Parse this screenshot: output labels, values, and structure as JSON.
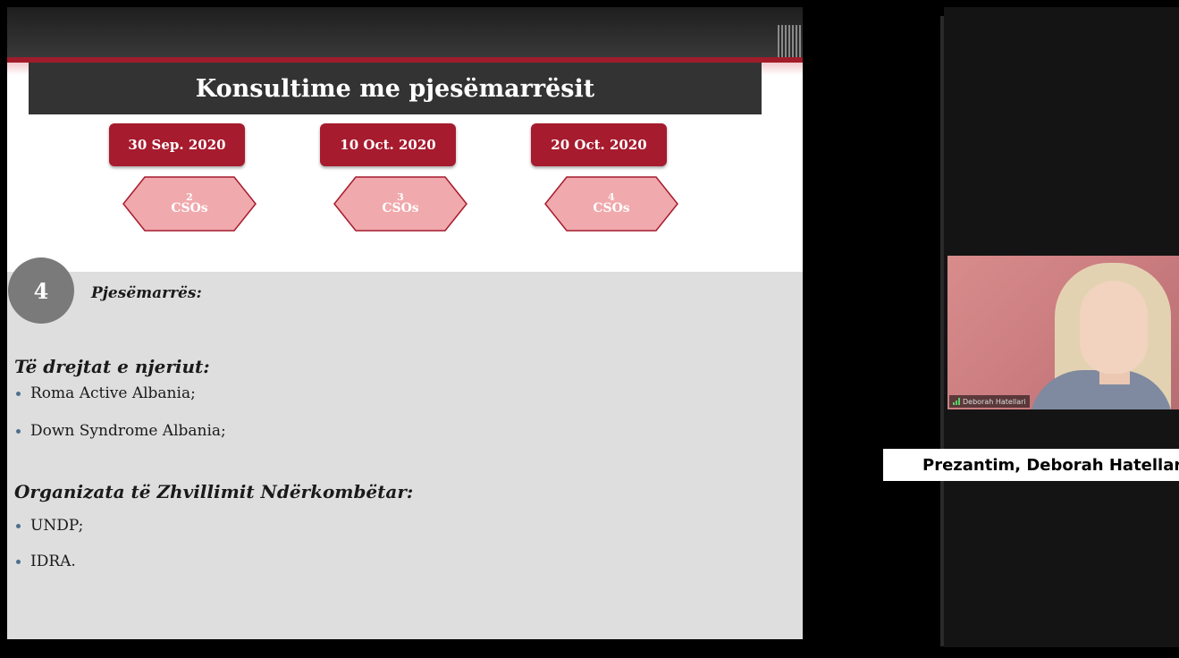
{
  "slide": {
    "title": "Konsultime me pjesëmarrësit",
    "dates": [
      {
        "date": "30 Sep. 2020",
        "count": "2",
        "unit": "CSOs"
      },
      {
        "date": "10 Oct. 2020",
        "count": "3",
        "unit": "CSOs"
      },
      {
        "date": "20 Oct. 2020",
        "count": "4",
        "unit": "CSOs"
      }
    ],
    "participant_count": "4",
    "participants_label": "Pjesëmarrës:",
    "sections": [
      {
        "heading": "Të drejtat e njeriut:",
        "items": [
          "Roma Active Albania;",
          "Down Syndrome Albania;"
        ]
      },
      {
        "heading": "Organizata të Zhvillimit Ndërkombëtar:",
        "items": [
          "UNDP;",
          "IDRA."
        ]
      }
    ]
  },
  "video": {
    "participant_name": "Deborah Hatellari"
  },
  "caption": {
    "text": "Prezantim, Deborah Hatellari"
  },
  "colors": {
    "accent_red": "#a61b2e",
    "hexagon_fill": "#f0a9ac",
    "banner_dark": "#333333",
    "panel_gray": "#dedede"
  }
}
